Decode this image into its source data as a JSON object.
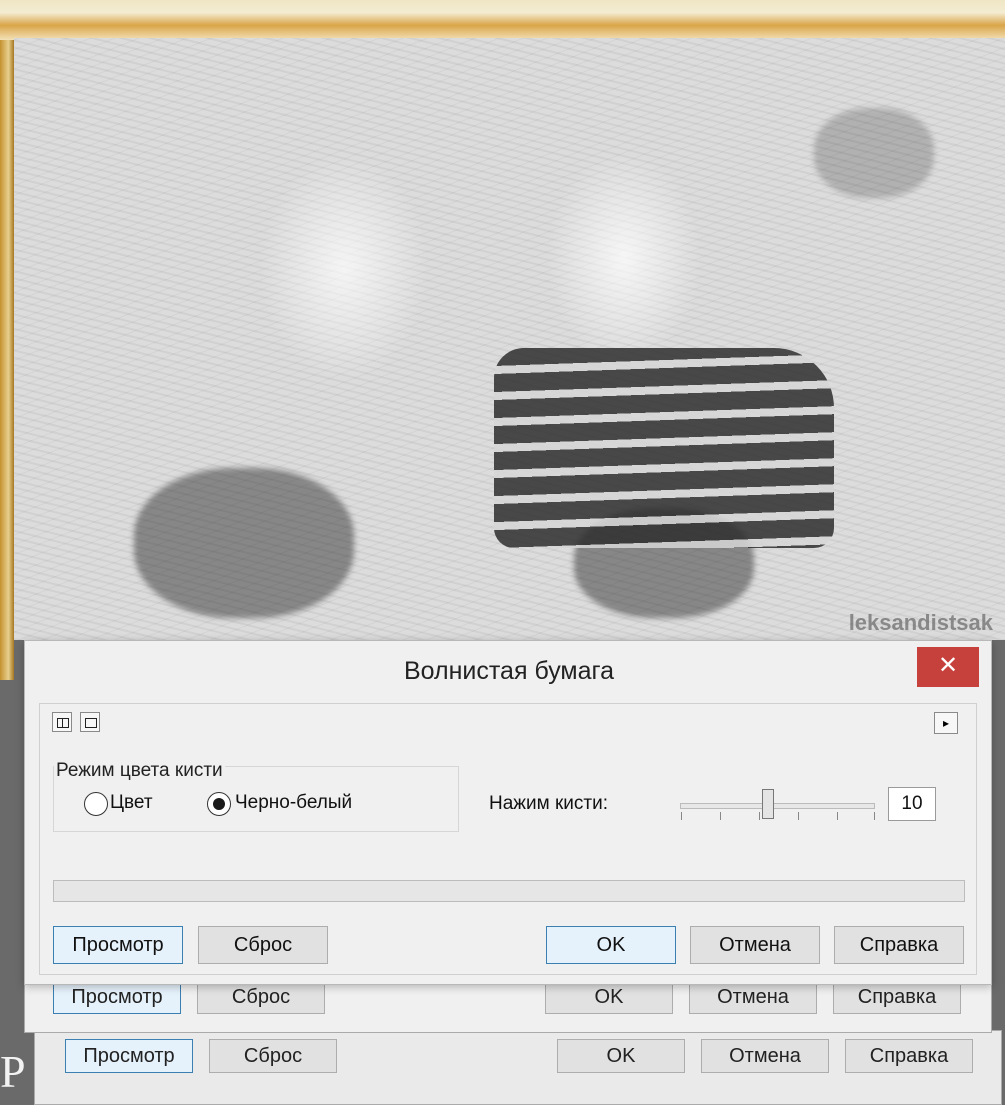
{
  "dialog": {
    "title": "Волнистая бумага",
    "close_label": "✕",
    "toolbar": {
      "icons": [
        "split-view-icon",
        "single-view-icon"
      ],
      "arrow_label": "▸"
    },
    "brush_mode": {
      "group_label": "Режим цвета кисти",
      "options": [
        {
          "label": "Цвет",
          "checked": false
        },
        {
          "label": "Черно-белый",
          "checked": true
        }
      ]
    },
    "brush_pressure": {
      "label": "Нажим кисти:",
      "value": "10",
      "slider_fraction": 0.45
    },
    "buttons": {
      "preview": "Просмотр",
      "reset": "Сброс",
      "ok": "OK",
      "cancel": "Отмена",
      "help": "Справка"
    }
  },
  "ghost_dialogs": {
    "buttons": [
      "Просмотр",
      "Сброс",
      "OK",
      "Отмена",
      "Справка"
    ]
  },
  "photo": {
    "watermark": "leksandistsak"
  },
  "colors": {
    "close_button": "#c7413c",
    "focus_blue": "#3c7fb1",
    "dialog_bg": "#f0f0f0"
  }
}
